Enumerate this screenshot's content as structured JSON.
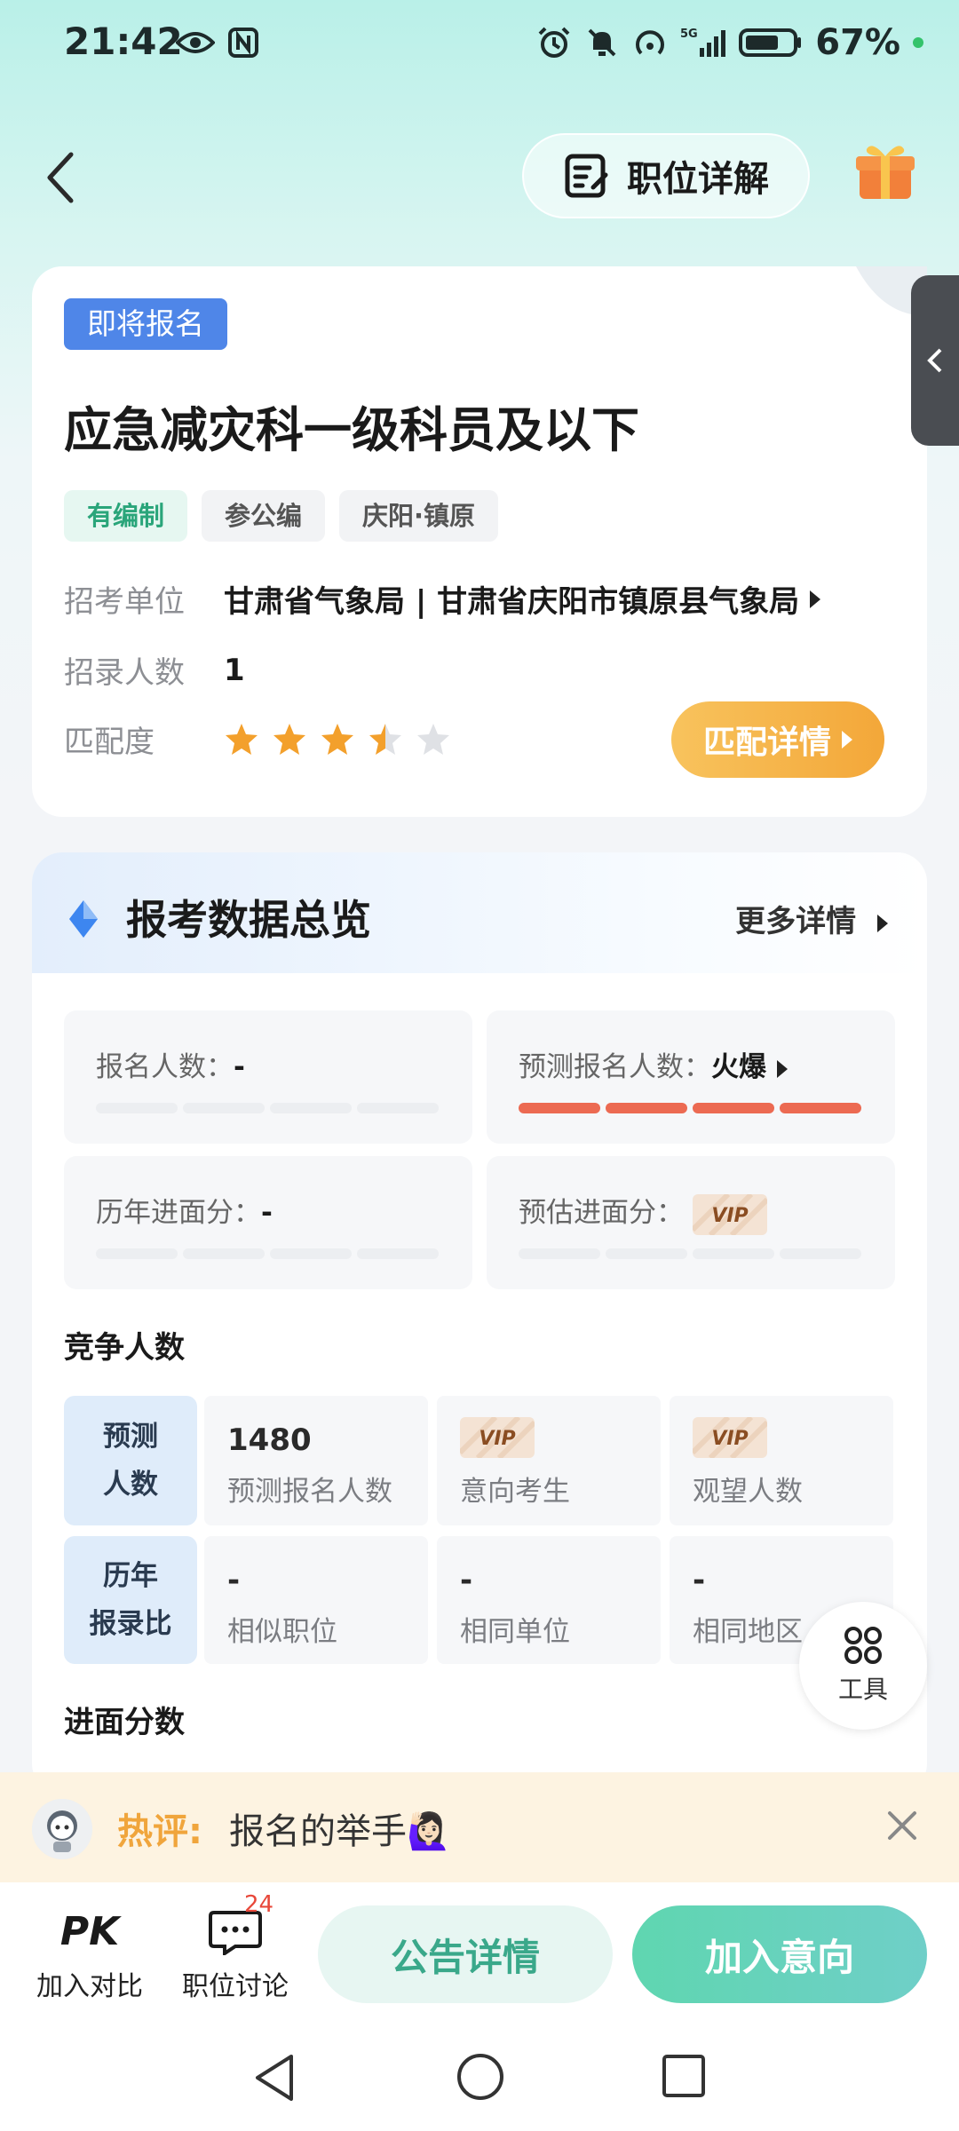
{
  "status_bar": {
    "time": "21:42",
    "battery_text": "67%",
    "network": "5G",
    "icons": [
      "eye-icon",
      "nfc-icon",
      "alarm-icon",
      "mute-icon",
      "hotspot-icon",
      "signal-icon",
      "battery-icon"
    ]
  },
  "header": {
    "title_button": "职位详解",
    "icons": [
      "back-arrow-icon",
      "document-edit-icon",
      "gift-icon"
    ]
  },
  "job": {
    "status_badge": "即将报名",
    "title": "应急减灾科一级科员及以下",
    "tags": [
      "有编制",
      "参公编",
      "庆阳·镇原"
    ],
    "employer_label": "招考单位",
    "employer_value": "甘肃省气象局 | 甘肃省庆阳市镇原县气象局",
    "headcount_label": "招录人数",
    "headcount_value": "1",
    "match_label": "匹配度",
    "match_rating": 3.5,
    "match_max": 5,
    "match_button": "匹配详情"
  },
  "overview": {
    "title": "报考数据总览",
    "more": "更多详情",
    "stats": {
      "applicants_label": "报名人数：",
      "applicants_value": "-",
      "predicted_label": "预测报名人数：",
      "predicted_value": "火爆",
      "hist_score_label": "历年进面分：",
      "hist_score_value": "-",
      "est_score_label": "预估进面分：",
      "vip_text": "VIP"
    },
    "competition_title": "竞争人数",
    "rows": [
      {
        "head": "预测\n人数",
        "cells": [
          {
            "value": "1480",
            "label": "预测报名人数"
          },
          {
            "value": "VIP",
            "label": "意向考生"
          },
          {
            "value": "VIP",
            "label": "观望人数"
          }
        ]
      },
      {
        "head": "历年\n报录比",
        "cells": [
          {
            "value": "-",
            "label": "相似职位"
          },
          {
            "value": "-",
            "label": "相同单位"
          },
          {
            "value": "-",
            "label": "相同地区"
          }
        ]
      }
    ],
    "score_title": "进面分数"
  },
  "tools": {
    "label": "工具"
  },
  "hot_comment": {
    "label": "热评:",
    "text": "报名的举手🙋🏻‍♀️"
  },
  "actions": {
    "compare_mark": "PK",
    "compare_label": "加入对比",
    "discuss_label": "职位讨论",
    "discuss_count": "24",
    "notice_button": "公告详情",
    "intent_button": "加入意向"
  },
  "colors": {
    "accent_green": "#3aa88a",
    "status_blue": "#4f86e8",
    "match_orange": "#f3a739",
    "hot_red": "#ec6a52",
    "star_orange": "#f3a02c"
  }
}
